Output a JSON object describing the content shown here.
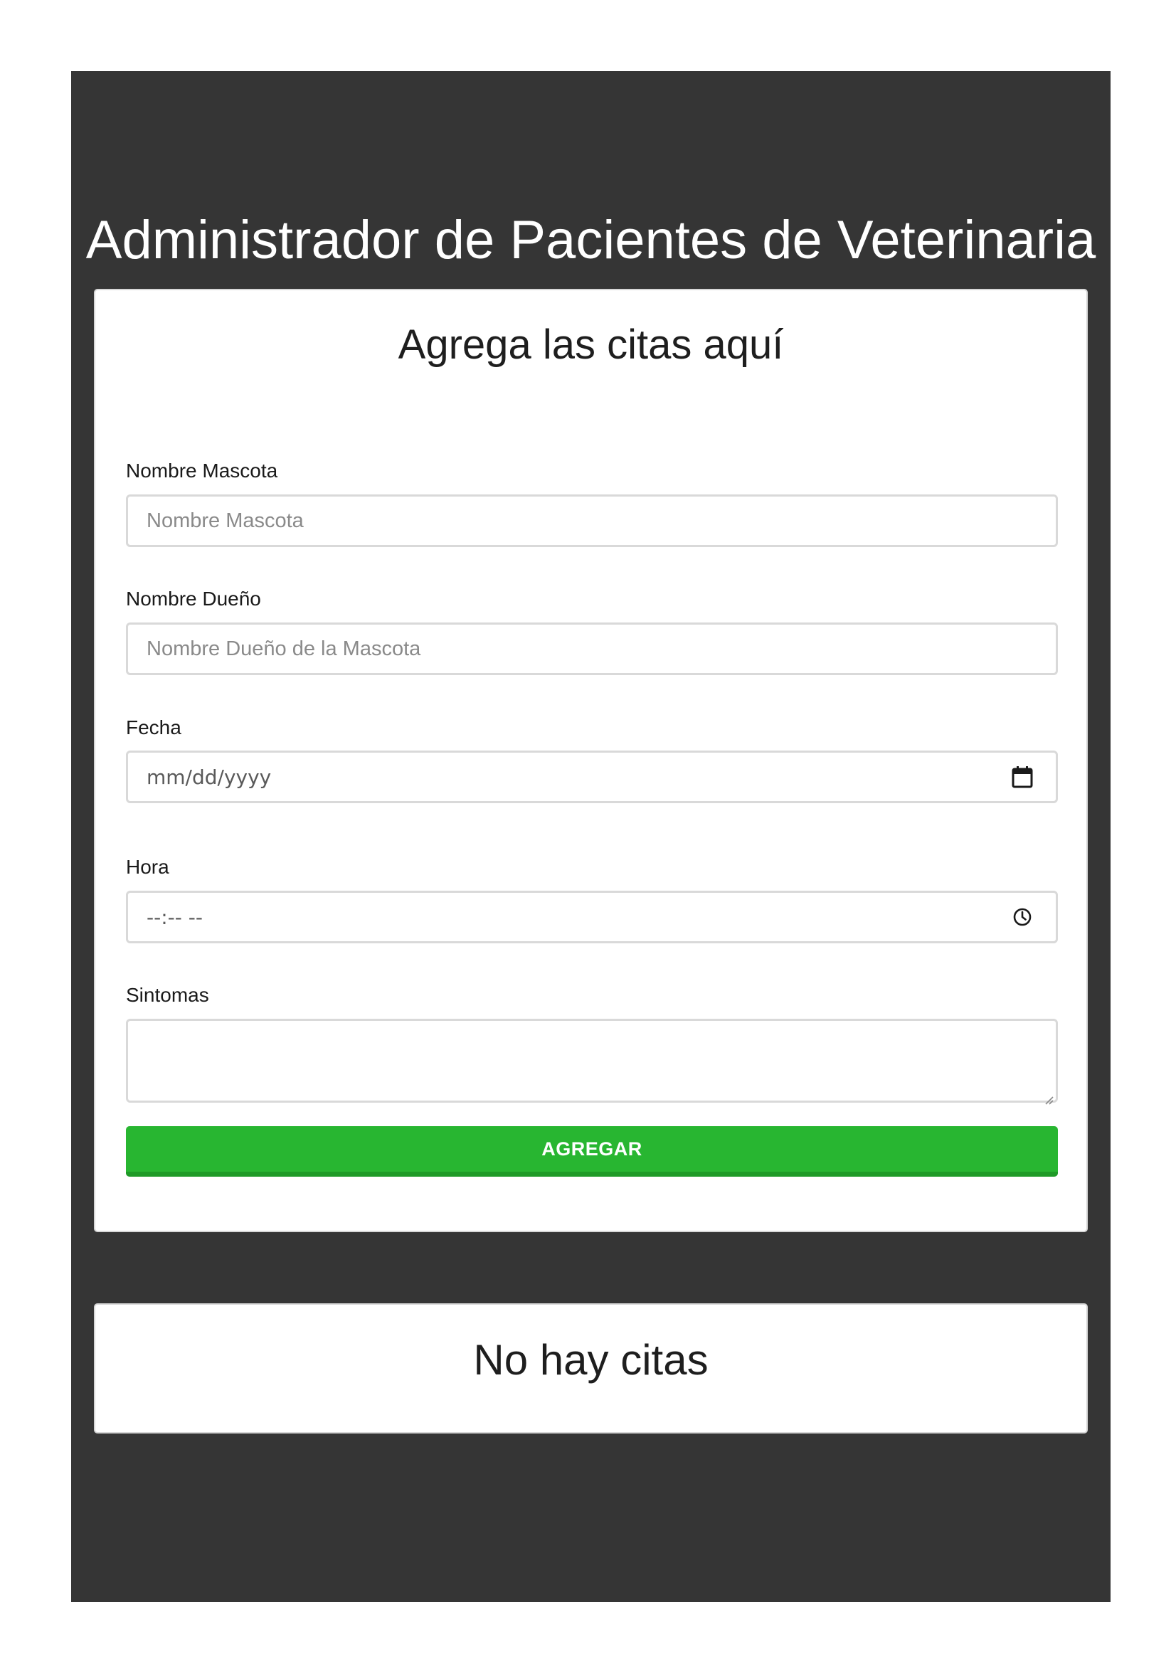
{
  "header": {
    "title": "Administrador de Pacientes de Veterinaria"
  },
  "form": {
    "heading": "Agrega las citas aquí",
    "fields": {
      "mascota": {
        "label": "Nombre Mascota",
        "placeholder": "Nombre Mascota"
      },
      "propietario": {
        "label": "Nombre Dueño",
        "placeholder": "Nombre Dueño de la Mascota"
      },
      "fecha": {
        "label": "Fecha",
        "mask": "mm/dd/yyyy",
        "icon": "calendar-icon"
      },
      "hora": {
        "label": "Hora",
        "mask": "--:-- --",
        "icon": "clock-icon"
      },
      "sintomas": {
        "label": "Sintomas",
        "value": ""
      }
    },
    "submit_label": "AGREGAR"
  },
  "appointments": {
    "empty_heading": "No hay citas"
  },
  "colors": {
    "background": "#353535",
    "submit": "#28b631"
  }
}
